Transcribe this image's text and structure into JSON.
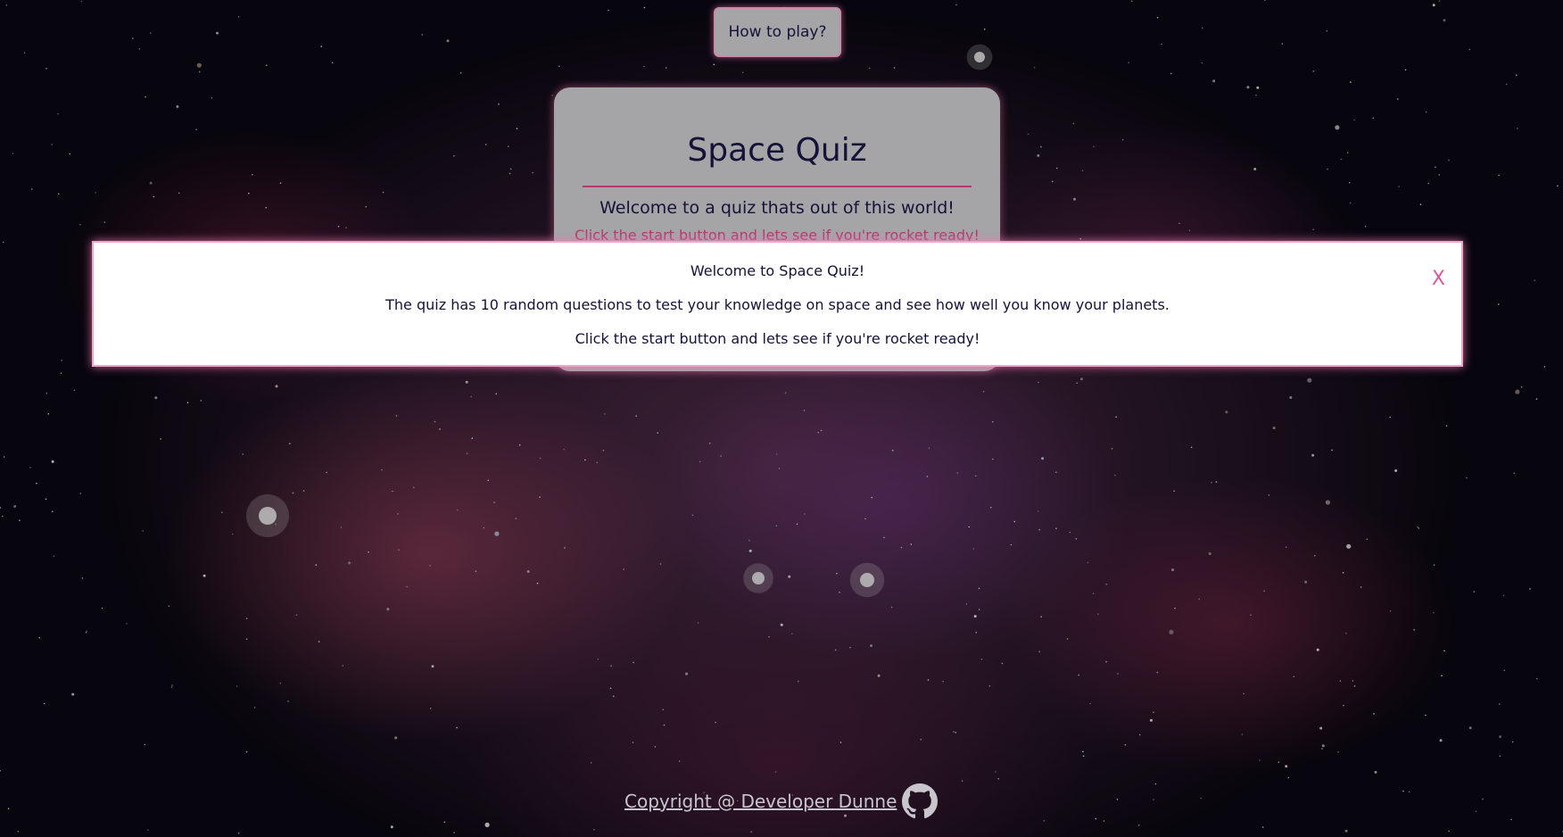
{
  "header": {
    "how_to_play_label": "How to play?"
  },
  "quiz_card": {
    "title": "Space Quiz",
    "welcome": "Welcome to a quiz thats out of this world!",
    "partially_hidden_line": "Click the start button and lets see if you're rocket ready!"
  },
  "modal": {
    "line1": "Welcome to Space Quiz!",
    "line2": "The quiz has 10 random questions to test your knowledge on space and see how well you know your planets.",
    "line3": "Click the start button and lets see if you're rocket ready!",
    "close_label": "X"
  },
  "footer": {
    "copyright_label": "Copyright @ Developer Dunne ",
    "icon": "github-icon"
  },
  "colors": {
    "card_background": "#a5a5a7",
    "text_navy": "#15123a",
    "accent_pink": "#e0589a",
    "divider": "#b2386f"
  }
}
